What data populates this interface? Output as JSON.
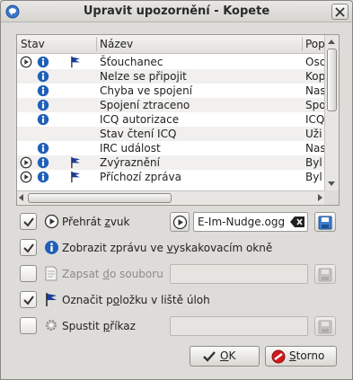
{
  "window": {
    "title": "Upravit upozornění - Kopete"
  },
  "table": {
    "headers": {
      "status": "Stav",
      "name": "Název",
      "popup": "Pop"
    },
    "rows": [
      {
        "name": "Šťouchanec",
        "popup": "Osc",
        "play": true,
        "info": true,
        "flag": true
      },
      {
        "name": "Nelze se připojit",
        "popup": "Kop",
        "play": false,
        "info": true,
        "flag": false
      },
      {
        "name": "Chyba ve spojení",
        "popup": "Nas",
        "play": false,
        "info": true,
        "flag": false
      },
      {
        "name": "Spojení ztraceno",
        "popup": "Spo",
        "play": false,
        "info": true,
        "flag": false
      },
      {
        "name": "ICQ autorizace",
        "popup": "ICQ",
        "play": false,
        "info": true,
        "flag": false
      },
      {
        "name": "Stav čtení ICQ",
        "popup": "Uži",
        "play": false,
        "info": false,
        "flag": false
      },
      {
        "name": "IRC událost",
        "popup": "Nas",
        "play": false,
        "info": true,
        "flag": false
      },
      {
        "name": "Zvýraznění",
        "popup": "Byl",
        "play": true,
        "info": true,
        "flag": true
      },
      {
        "name": "Příchozí zpráva",
        "popup": "Byl",
        "play": true,
        "info": true,
        "flag": true
      }
    ]
  },
  "options": {
    "play_sound": {
      "prefix": "Přehrát ",
      "underlined": "z",
      "suffix": "vuk",
      "checked": true,
      "file": "E-Im-Nudge.ogg"
    },
    "show_popup": {
      "prefix": "Zobrazit zprávu ve ",
      "underlined": "v",
      "suffix": "yskakovacím okně",
      "checked": true
    },
    "log_file": {
      "prefix": "Zapsat ",
      "underlined": "d",
      "suffix": "o souboru",
      "checked": false
    },
    "mark_taskbar": {
      "prefix": "Označit p",
      "underlined": "o",
      "suffix": "ložku v liště úloh",
      "checked": true
    },
    "run_command": {
      "prefix": "Spustit ",
      "underlined": "p",
      "suffix": "říkaz",
      "checked": false
    }
  },
  "buttons": {
    "ok": {
      "underlined": "O",
      "suffix": "K"
    },
    "cancel": {
      "underlined": "S",
      "suffix": "torno"
    }
  },
  "colors": {
    "info_blue": "#1f5fb8",
    "flag_blue": "#1c3d9c",
    "cancel_red": "#cc1c1c",
    "ok_green": "#2a8a1e"
  },
  "icons": [
    "app-icon",
    "close-icon",
    "play-icon",
    "info-icon",
    "flag-icon",
    "clear-icon",
    "save-icon",
    "document-icon",
    "gear-icon",
    "checkmark-icon",
    "cancel-icon"
  ]
}
